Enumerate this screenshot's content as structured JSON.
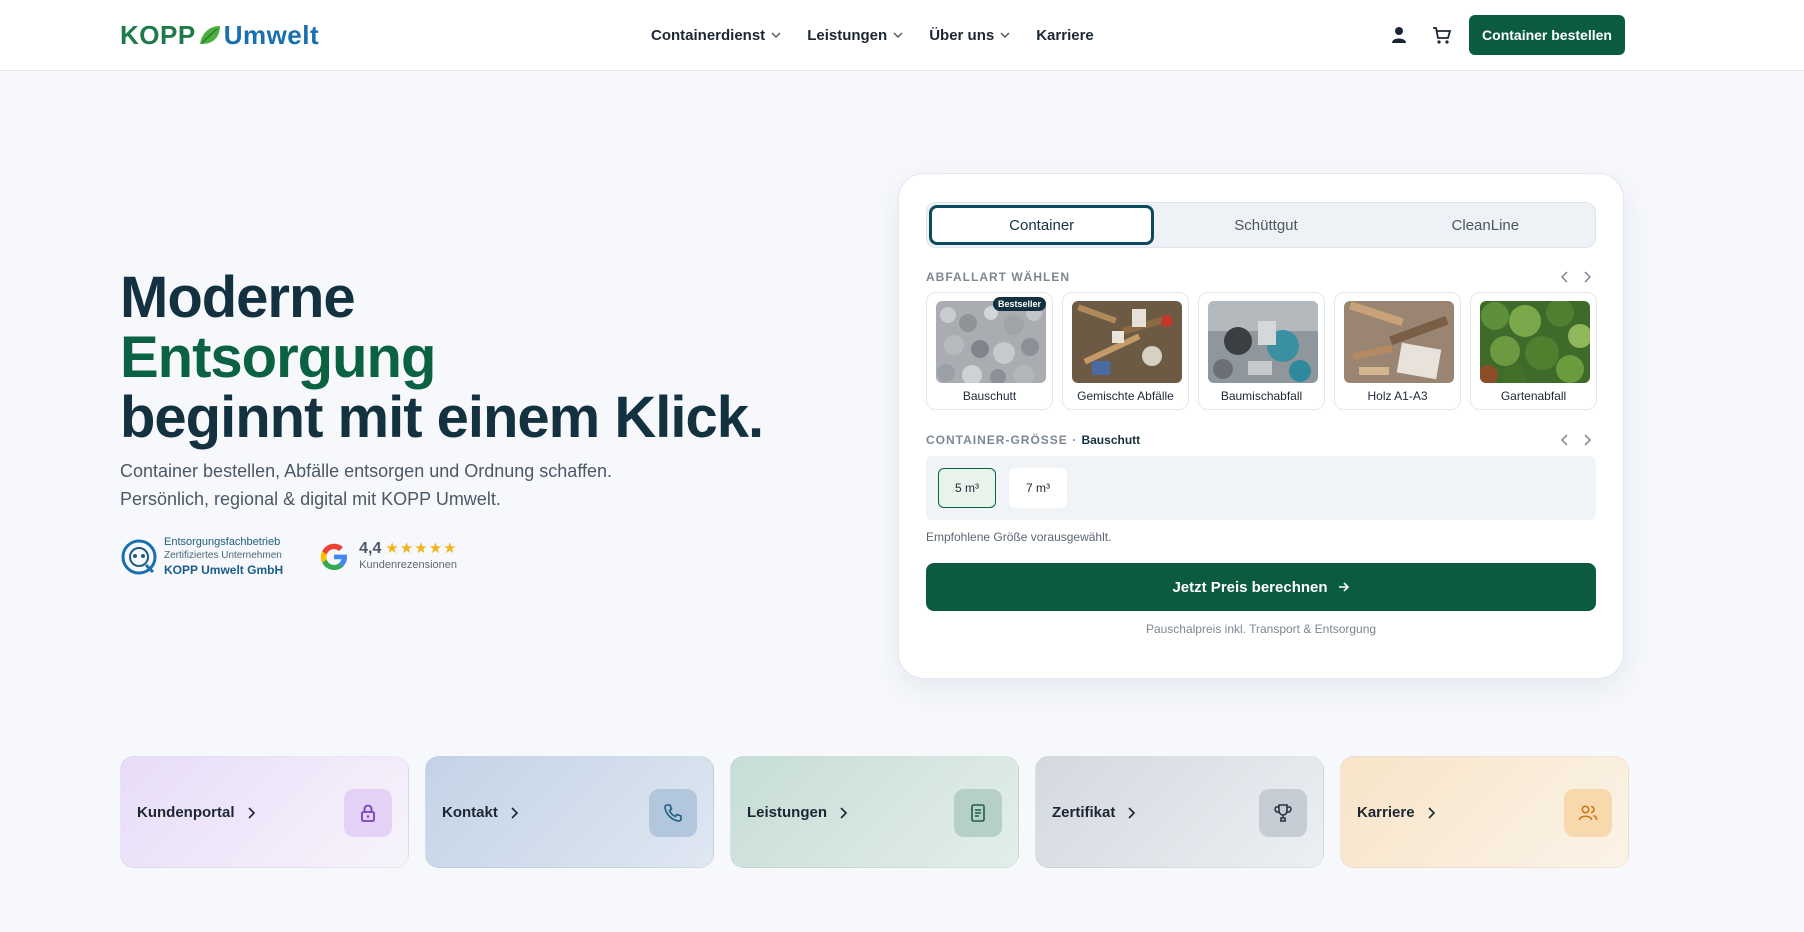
{
  "header": {
    "logo_part1": "KOPP",
    "logo_part2": "Umwelt",
    "nav": [
      {
        "label": "Containerdienst",
        "dropdown": true
      },
      {
        "label": "Leistungen",
        "dropdown": true
      },
      {
        "label": "Über uns",
        "dropdown": true
      },
      {
        "label": "Karriere",
        "dropdown": false
      }
    ],
    "icons": [
      "user-icon",
      "cart-icon"
    ],
    "cta_label": "Container bestellen"
  },
  "hero": {
    "line1": "Moderne",
    "line2": "Entsorgung",
    "line3": "beginnt mit einem Klick.",
    "sub1": "Container bestellen, Abfälle entsorgen und Ordnung schaffen.",
    "sub2": "Persönlich, regional & digital mit KOPP Umwelt.",
    "cert": {
      "line1": "Entsorgungsfachbetrieb",
      "line2": "Zertifiziertes Unternehmen",
      "line3": "KOPP Umwelt GmbH"
    },
    "rating": {
      "score": "4,4",
      "stars": "★★★★★",
      "label": "Kundenrezensionen"
    }
  },
  "order": {
    "tabs": [
      {
        "label": "Container",
        "active": true
      },
      {
        "label": "Schüttgut",
        "active": false
      },
      {
        "label": "CleanLine",
        "active": false
      }
    ],
    "waste_label": "ABFALLART WÄHLEN",
    "waste_types": [
      {
        "label": "Bauschutt",
        "badge": "Bestseller"
      },
      {
        "label": "Gemischte Abfälle",
        "badge": ""
      },
      {
        "label": "Baumischabfall",
        "badge": ""
      },
      {
        "label": "Holz A1-A3",
        "badge": ""
      },
      {
        "label": "Gartenabfall",
        "badge": ""
      }
    ],
    "size_label": "CONTAINER-GRÖSSE ·",
    "size_selected_type": "Bauschutt",
    "sizes": [
      {
        "label": "5 m³",
        "selected": true
      },
      {
        "label": "7 m³",
        "selected": false
      }
    ],
    "recommend_text": "Empfohlene Größe vorausgewählt.",
    "calc_label": "Jetzt Preis berechnen",
    "price_note": "Pauschalpreis inkl. Transport & Entsorgung"
  },
  "quick_links": [
    {
      "label": "Kundenportal",
      "icon": "lock-icon"
    },
    {
      "label": "Kontakt",
      "icon": "phone-icon"
    },
    {
      "label": "Leistungen",
      "icon": "document-icon"
    },
    {
      "label": "Zertifikat",
      "icon": "trophy-icon"
    },
    {
      "label": "Karriere",
      "icon": "users-icon"
    }
  ],
  "colors": {
    "brand_green": "#0b5b42",
    "brand_blue": "#1a6fae",
    "heading": "#13313f"
  }
}
